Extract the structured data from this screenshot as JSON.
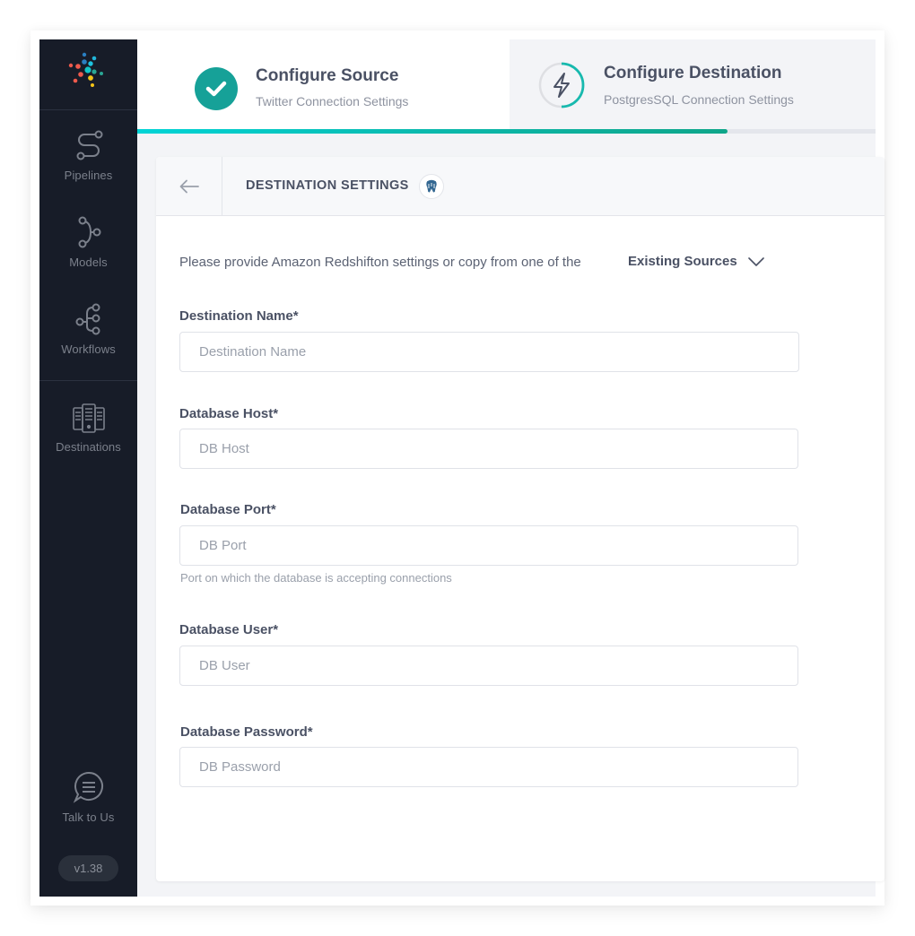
{
  "sidebar": {
    "logo": "hevo-logo",
    "items": [
      {
        "label": "Pipelines",
        "icon": "pipelines-icon"
      },
      {
        "label": "Models",
        "icon": "models-icon"
      },
      {
        "label": "Workflows",
        "icon": "workflows-icon"
      },
      {
        "label": "Destinations",
        "icon": "destinations-icon"
      }
    ],
    "talk": {
      "label": "Talk to Us",
      "icon": "chat-icon"
    },
    "version": "v1.38"
  },
  "stepper": {
    "steps": [
      {
        "title": "Configure Source",
        "subtitle": "Twitter Connection Settings",
        "status": "complete",
        "icon": "check-icon"
      },
      {
        "title": "Configure Destination",
        "subtitle": "PostgresSQL Connection Settings",
        "status": "in-progress",
        "icon": "lightning-icon"
      }
    ],
    "progress_percent": 80,
    "colors": {
      "complete": "#16a198",
      "progress_start": "#00d4d6",
      "progress_end": "#0fa68a"
    }
  },
  "card": {
    "title": "DESTINATION SETTINGS",
    "badge_icon": "postgresql-icon",
    "intro": "Please provide Amazon Redshifton settings or copy from one of the",
    "existing_sources": "Existing Sources",
    "fields": [
      {
        "label": "Destination Name*",
        "placeholder": "Destination Name",
        "value": ""
      },
      {
        "label": "Database Host*",
        "placeholder": "DB Host",
        "value": ""
      },
      {
        "label": "Database Port*",
        "placeholder": "DB Port",
        "value": "",
        "help": "Port on which the database is accepting connections"
      },
      {
        "label": "Database User*",
        "placeholder": "DB User",
        "value": ""
      },
      {
        "label": "Database Password*",
        "placeholder": "DB Password",
        "value": ""
      }
    ]
  }
}
